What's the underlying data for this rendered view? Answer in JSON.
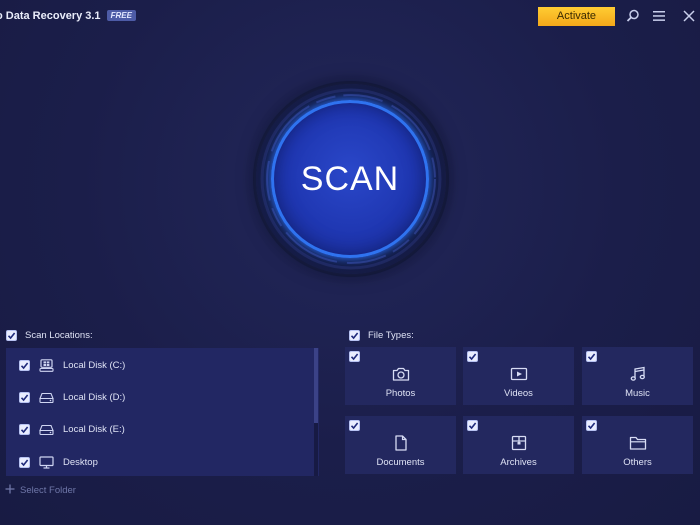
{
  "window": {
    "title": "o Data Recovery 3.1",
    "badge": "FREE",
    "activate_label": "Activate"
  },
  "scan": {
    "label": "SCAN"
  },
  "scan_locations": {
    "header": "Scan Locations:",
    "checked": true,
    "items": [
      {
        "label": "Local Disk (C:)",
        "icon": "windows-drive-icon",
        "checked": true
      },
      {
        "label": "Local Disk (D:)",
        "icon": "hard-drive-icon",
        "checked": true
      },
      {
        "label": "Local Disk (E:)",
        "icon": "hard-drive-icon",
        "checked": true
      },
      {
        "label": "Desktop",
        "icon": "monitor-icon",
        "checked": true
      }
    ],
    "select_folder_label": "Select Folder"
  },
  "file_types": {
    "header": "File Types:",
    "checked": true,
    "items": [
      {
        "label": "Photos",
        "icon": "camera-icon",
        "checked": true
      },
      {
        "label": "Videos",
        "icon": "video-icon",
        "checked": true
      },
      {
        "label": "Music",
        "icon": "music-note-icon",
        "checked": true
      },
      {
        "label": "Documents",
        "icon": "document-icon",
        "checked": true
      },
      {
        "label": "Archives",
        "icon": "archive-icon",
        "checked": true
      },
      {
        "label": "Others",
        "icon": "folder-icon",
        "checked": true
      }
    ]
  },
  "colors": {
    "background": "#1b1e4a",
    "panel": "#222763",
    "accent_blue": "#2f73f0",
    "activate_yellow": "#f4b41e"
  }
}
